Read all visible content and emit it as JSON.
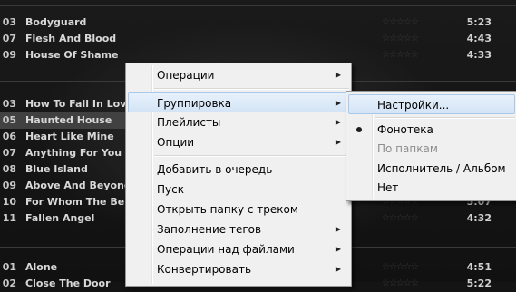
{
  "tracks_top": [
    {
      "num": "03",
      "title": "Bodyguard",
      "dur": "5:23"
    },
    {
      "num": "07",
      "title": "Flesh And Blood",
      "dur": "4:43"
    },
    {
      "num": "09",
      "title": "House Of Shame",
      "dur": "4:33"
    }
  ],
  "tracks_mid": [
    {
      "num": "03",
      "title": "How To Fall In Love",
      "dur": ""
    },
    {
      "num": "05",
      "title": "Haunted House",
      "dur": ""
    },
    {
      "num": "06",
      "title": "Heart Like Mine",
      "dur": ""
    },
    {
      "num": "07",
      "title": "Anything For You",
      "dur": ""
    },
    {
      "num": "08",
      "title": "Blue Island",
      "dur": ""
    },
    {
      "num": "09",
      "title": "Above And Beyond",
      "dur": ""
    },
    {
      "num": "10",
      "title": "For Whom The Bell T",
      "dur": "5:07"
    },
    {
      "num": "11",
      "title": "Fallen Angel",
      "dur": "4:32"
    }
  ],
  "tracks_bottom": [
    {
      "num": "01",
      "title": "Alone",
      "dur": "4:51"
    },
    {
      "num": "02",
      "title": "Close The Door",
      "dur": "5:22"
    }
  ],
  "stars": "☆☆☆☆☆",
  "context_menu": {
    "items": [
      "Операции",
      "Группировка",
      "Плейлисты",
      "Опции",
      "Добавить в очередь",
      "Пуск",
      "Открыть папку с треком",
      "Заполнение тегов",
      "Операции над файлами",
      "Конвертировать"
    ],
    "arrow": "▶"
  },
  "submenu": {
    "items": [
      "Настройки...",
      "Фонотека",
      "По папкам",
      "Исполнитель / Альбом",
      "Нет"
    ]
  }
}
